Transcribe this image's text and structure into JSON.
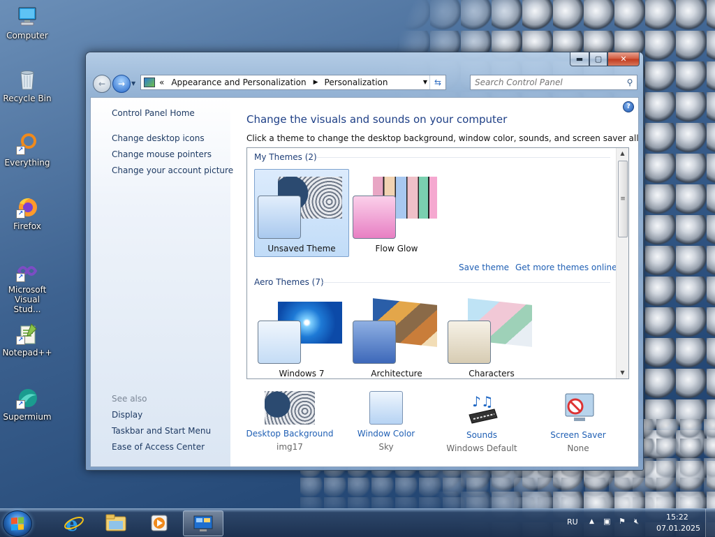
{
  "desktop": {
    "icons": [
      {
        "label": "Computer",
        "icon": "computer-icon"
      },
      {
        "label": "Recycle Bin",
        "icon": "recycle-bin-icon"
      },
      {
        "label": "Everything",
        "icon": "everything-app-icon"
      },
      {
        "label": "Firefox",
        "icon": "firefox-icon"
      },
      {
        "label": "Microsoft Visual Stud...",
        "icon": "visual-studio-icon"
      },
      {
        "label": "Notepad++",
        "icon": "notepad-plus-plus-icon"
      },
      {
        "label": "Supermium",
        "icon": "supermium-icon"
      }
    ]
  },
  "window": {
    "caption_buttons": {
      "minimize": "▬",
      "maximize": "▢",
      "close": "✕"
    },
    "breadcrumb": {
      "overflow": "«",
      "items": [
        "Appearance and Personalization",
        "Personalization"
      ],
      "separator": "▶"
    },
    "search": {
      "placeholder": "Search Control Panel"
    },
    "left_pane": {
      "home": "Control Panel Home",
      "links": [
        "Change desktop icons",
        "Change mouse pointers",
        "Change your account picture"
      ],
      "see_also_label": "See also",
      "see_also": [
        "Display",
        "Taskbar and Start Menu",
        "Ease of Access Center"
      ]
    },
    "main": {
      "help": "?",
      "title": "Change the visuals and sounds on your computer",
      "subtitle": "Click a theme to change the desktop background, window color, sounds, and screen saver all at once.",
      "my_themes": {
        "heading": "My Themes (2)",
        "items": [
          {
            "name": "Unsaved Theme",
            "selected": true
          },
          {
            "name": "Flow Glow",
            "selected": false
          }
        ],
        "save_link": "Save theme",
        "online_link": "Get more themes online"
      },
      "aero_themes": {
        "heading": "Aero Themes (7)",
        "items": [
          {
            "name": "Windows 7"
          },
          {
            "name": "Architecture"
          },
          {
            "name": "Characters"
          }
        ]
      },
      "bottom": [
        {
          "label": "Desktop Background",
          "value": "img17"
        },
        {
          "label": "Window Color",
          "value": "Sky"
        },
        {
          "label": "Sounds",
          "value": "Windows Default"
        },
        {
          "label": "Screen Saver",
          "value": "None"
        }
      ]
    }
  },
  "taskbar": {
    "pinned": [
      "start-button",
      "internet-explorer",
      "windows-explorer",
      "media-player",
      "control-panel"
    ],
    "tray": {
      "language": "RU",
      "time": "15:22",
      "date": "07.01.2025"
    }
  },
  "colors": {
    "link": "#1f5fb4",
    "title": "#1e3f86",
    "selection": "#c1dcf8"
  }
}
